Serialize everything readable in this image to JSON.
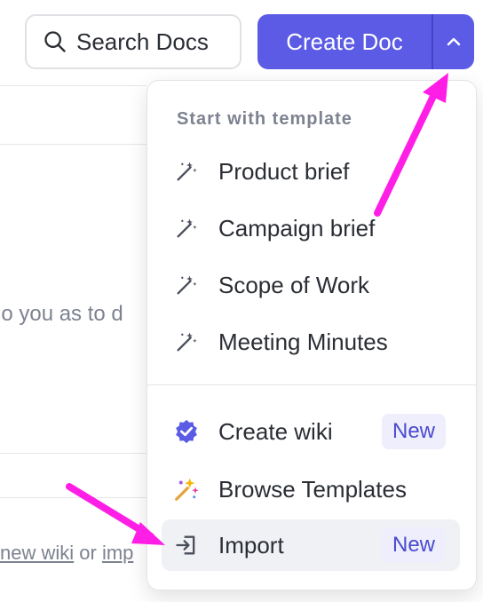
{
  "header": {
    "search_label": "Search Docs",
    "create_label": "Create Doc"
  },
  "background": {
    "partial_text": "lo you as to d",
    "link_new_wiki": "new wiki",
    "link_or": "or",
    "link_import": "imp"
  },
  "menu": {
    "heading": "Start with template",
    "templates": [
      {
        "label": "Product brief",
        "icon": "magic-wand-icon"
      },
      {
        "label": "Campaign brief",
        "icon": "magic-wand-icon"
      },
      {
        "label": "Scope of Work",
        "icon": "magic-wand-icon"
      },
      {
        "label": "Meeting Minutes",
        "icon": "magic-wand-icon"
      }
    ],
    "actions": [
      {
        "label": "Create wiki",
        "icon": "verified-badge-icon",
        "badge": "New"
      },
      {
        "label": "Browse Templates",
        "icon": "sparkle-wand-icon"
      },
      {
        "label": "Import",
        "icon": "import-icon",
        "badge": "New"
      }
    ]
  },
  "colors": {
    "accent": "#5b5be6",
    "annotation_arrow": "#ff1ee6",
    "badge_bg": "#eeeefc",
    "badge_text": "#4a4ad0"
  }
}
